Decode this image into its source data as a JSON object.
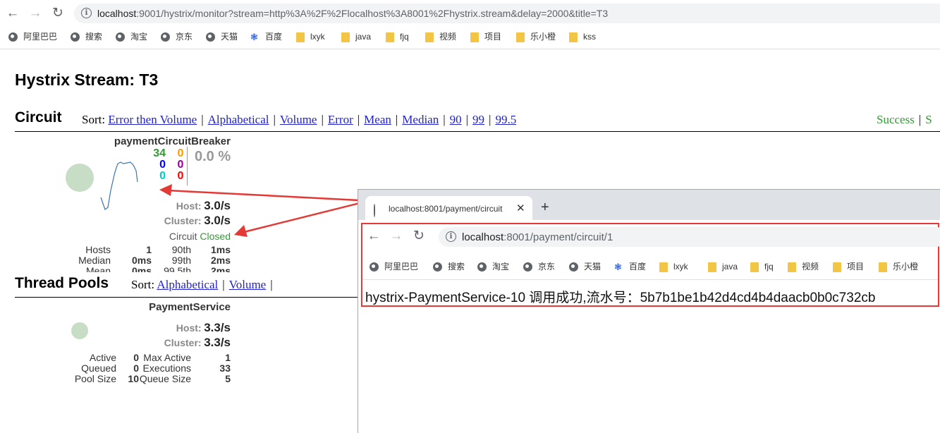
{
  "browser": {
    "url_host": "localhost",
    "url_rest": ":9001/hystrix/monitor?stream=http%3A%2F%2Flocalhost%3A8001%2Fhystrix.stream&delay=2000&title=T3",
    "bookmarks": [
      {
        "label": "阿里巴巴",
        "icon": "globe-icon"
      },
      {
        "label": "搜索",
        "icon": "globe-icon"
      },
      {
        "label": "淘宝",
        "icon": "globe-icon"
      },
      {
        "label": "京东",
        "icon": "globe-icon"
      },
      {
        "label": "天猫",
        "icon": "globe-icon"
      },
      {
        "label": "百度",
        "icon": "baidu-paw-icon"
      },
      {
        "label": "lxyk",
        "icon": "folder-icon"
      },
      {
        "label": "java",
        "icon": "folder-icon"
      },
      {
        "label": "fjq",
        "icon": "folder-icon"
      },
      {
        "label": "视频",
        "icon": "folder-icon"
      },
      {
        "label": "项目",
        "icon": "folder-icon"
      },
      {
        "label": "乐小橙",
        "icon": "folder-icon"
      },
      {
        "label": "kss",
        "icon": "folder-icon"
      }
    ]
  },
  "dashboard": {
    "title": "Hystrix Stream: T3",
    "circuit": {
      "heading": "Circuit",
      "sort_label": "Sort:",
      "sort_options": [
        "Error then Volume",
        "Alphabetical",
        "Volume",
        "Error",
        "Mean",
        "Median",
        "90",
        "99",
        "99.5"
      ],
      "legend_success": "Success",
      "legend_trailing": "S",
      "card": {
        "name": "paymentCircuitBreaker",
        "count_success": "34",
        "count_short": "0",
        "count_timeout": "0",
        "count_badreq": "0",
        "count_failure": "0",
        "count_rejected": "0",
        "count_error_rate": "0.0 %",
        "host_label": "Host:",
        "host_value": "3.0/s",
        "cluster_label": "Cluster:",
        "cluster_value": "3.0/s",
        "circuit_label": "Circuit",
        "circuit_status": "Closed",
        "stats": [
          {
            "l1": "Hosts",
            "v1": "1",
            "l2": "90th",
            "v2": "1ms"
          },
          {
            "l1": "Median",
            "v1": "0ms",
            "l2": "99th",
            "v2": "2ms"
          },
          {
            "l1": "Mean",
            "v1": "0ms",
            "l2": "99.5th",
            "v2": "2ms"
          }
        ]
      }
    },
    "thread_pools": {
      "heading": "Thread Pools",
      "sort_label": "Sort:",
      "sort_options": [
        "Alphabetical",
        "Volume"
      ],
      "card": {
        "name": "PaymentService",
        "host_label": "Host:",
        "host_value": "3.3/s",
        "cluster_label": "Cluster:",
        "cluster_value": "3.3/s",
        "stats": [
          {
            "l1": "Active",
            "v1": "0",
            "l2": "Max Active",
            "v2": "1"
          },
          {
            "l1": "Queued",
            "v1": "0",
            "l2": "Executions",
            "v2": "33"
          },
          {
            "l1": "Pool Size",
            "v1": "10",
            "l2": "Queue Size",
            "v2": "5"
          }
        ]
      }
    }
  },
  "popup": {
    "tab_title": "localhost:8001/payment/circuit",
    "url_host": "localhost",
    "url_rest": ":8001/payment/circuit/1",
    "bookmarks": [
      {
        "label": "阿里巴巴",
        "icon": "globe-icon"
      },
      {
        "label": "搜索",
        "icon": "globe-icon"
      },
      {
        "label": "淘宝",
        "icon": "globe-icon"
      },
      {
        "label": "京东",
        "icon": "globe-icon"
      },
      {
        "label": "天猫",
        "icon": "globe-icon"
      },
      {
        "label": "百度",
        "icon": "baidu-paw-icon"
      },
      {
        "label": "lxyk",
        "icon": "folder-icon"
      },
      {
        "label": "java",
        "icon": "folder-icon"
      },
      {
        "label": "fjq",
        "icon": "folder-icon"
      },
      {
        "label": "视频",
        "icon": "folder-icon"
      },
      {
        "label": "项目",
        "icon": "folder-icon"
      },
      {
        "label": "乐小橙",
        "icon": "folder-icon"
      }
    ],
    "response_text": "hystrix-PaymentService-10 调用成功,流水号：5b7b1be1b42d4cd4b4daacb0b0c732cb"
  },
  "colors": {
    "success": "#339933",
    "short_circuited": "#0000ff",
    "timeout": "#ff9900",
    "bad_request": "#00cccc",
    "failure": "#990099",
    "rejected": "#ff0000",
    "annotation_arrow": "#e53935"
  }
}
